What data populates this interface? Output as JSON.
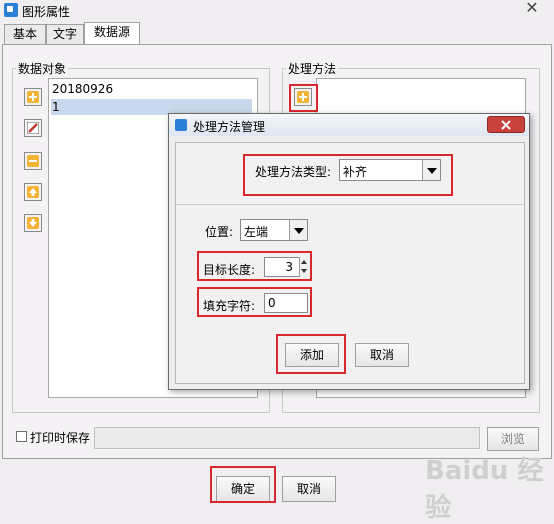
{
  "window": {
    "title": "图形属性",
    "close_label": "✕"
  },
  "tabs": [
    {
      "label": "基本"
    },
    {
      "label": "文字"
    },
    {
      "label": "数据源",
      "active": true
    }
  ],
  "data_objects": {
    "label": "数据对象",
    "items": [
      "20180926",
      "1"
    ],
    "selected_index": 1,
    "buttons": [
      {
        "name": "add-icon",
        "color": "#f5a623"
      },
      {
        "name": "edit-icon",
        "color": "#c0392b"
      },
      {
        "name": "remove-icon",
        "color": "#f5a623"
      },
      {
        "name": "move-up-icon",
        "color": "#f5a623"
      },
      {
        "name": "move-down-icon",
        "color": "#f5a623"
      }
    ]
  },
  "process_method": {
    "label": "处理方法",
    "add_icon": "add-icon"
  },
  "dialog": {
    "title": "处理方法管理",
    "type_label": "处理方法类型:",
    "type_value": "补齐",
    "position_label": "位置:",
    "position_value": "左端",
    "target_length_label": "目标长度:",
    "target_length_value": "3",
    "fill_char_label": "填充字符:",
    "fill_char_value": "0",
    "add_button": "添加",
    "cancel_button": "取消"
  },
  "print_save": {
    "label": "打印时保存",
    "checked": false,
    "path_value": "",
    "browse_button": "浏览"
  },
  "footer": {
    "ok_button": "确定",
    "cancel_button": "取消"
  },
  "watermark": "Baidu 经验",
  "accent_color": "#d8282e"
}
